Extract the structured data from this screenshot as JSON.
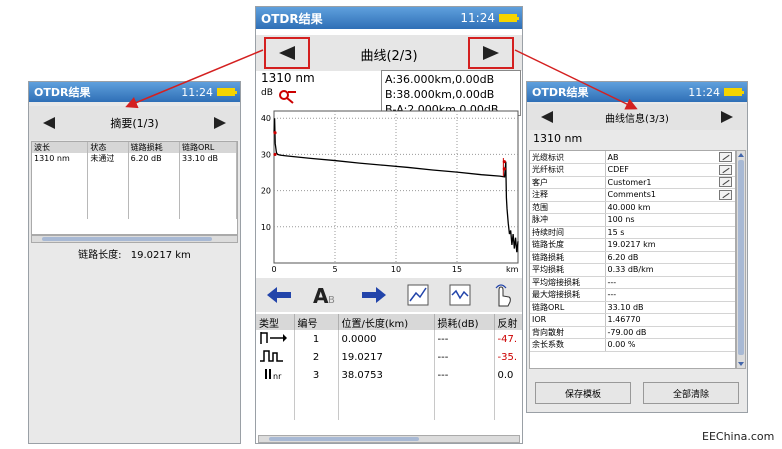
{
  "left": {
    "title": "OTDR结果",
    "time": "11:24",
    "nav_title": "摘要(1/3)",
    "columns": [
      "波长",
      "状态",
      "链路损耗",
      "链路ORL"
    ],
    "rows": [
      [
        "1310 nm",
        "未通过",
        "6.20 dB",
        "33.10 dB"
      ]
    ],
    "distance_label": "链路长度:",
    "distance_value": "19.0217 km"
  },
  "center": {
    "title": "OTDR结果",
    "time": "11:24",
    "nav_title": "曲线(2/3)",
    "wavelength": "1310 nm",
    "marker_a": "A:36.000km,0.00dB",
    "marker_b": "B:38.000km,0.00dB",
    "marker_ba": "B-A:2.000km,0.00dB",
    "y_unit": "dB",
    "x_unit": "km",
    "event_columns": [
      "类型",
      "编号",
      "位置/长度(km)",
      "损耗(dB)",
      "反射"
    ],
    "events": [
      {
        "type_icon": "launch-event-icon",
        "no": "1",
        "pos": "0.0000",
        "loss": "---",
        "refl": "-47.",
        "refl_color": "#cc0000"
      },
      {
        "type_icon": "reflective-event-icon",
        "no": "2",
        "pos": "19.0217",
        "loss": "---",
        "refl": "-35.",
        "refl_color": "#cc0000"
      },
      {
        "type_icon": "end-event-icon",
        "no": "3",
        "pos": "38.0753",
        "loss": "---",
        "refl": "0.0",
        "refl_color": "#000000"
      }
    ]
  },
  "right": {
    "title": "OTDR结果",
    "time": "11:24",
    "nav_title": "曲线信息(3/3)",
    "wavelength": "1310 nm",
    "info": [
      {
        "k": "光缆标识",
        "v": "AB",
        "edit": true
      },
      {
        "k": "光纤标识",
        "v": "CDEF",
        "edit": true
      },
      {
        "k": "客户",
        "v": "Customer1",
        "edit": true
      },
      {
        "k": "注释",
        "v": "Comments1",
        "edit": true
      },
      {
        "k": "范围",
        "v": "40.000 km",
        "edit": false
      },
      {
        "k": "脉冲",
        "v": "100 ns",
        "edit": false
      },
      {
        "k": "持续时间",
        "v": "15 s",
        "edit": false
      },
      {
        "k": "链路长度",
        "v": "19.0217 km",
        "edit": false
      },
      {
        "k": "链路损耗",
        "v": "6.20 dB",
        "edit": false
      },
      {
        "k": "平均损耗",
        "v": "0.33 dB/km",
        "edit": false
      },
      {
        "k": "平均熔接损耗",
        "v": "---",
        "edit": false
      },
      {
        "k": "最大熔接损耗",
        "v": "---",
        "edit": false
      },
      {
        "k": "链路ORL",
        "v": "33.10 dB",
        "edit": false
      },
      {
        "k": "IOR",
        "v": "1.46770",
        "edit": false
      },
      {
        "k": "背向散射",
        "v": "-79.00 dB",
        "edit": false
      },
      {
        "k": "余长系数",
        "v": "0.00 %",
        "edit": false
      }
    ],
    "save_label": "保存模板",
    "clear_label": "全部清除"
  },
  "watermark": "EEChina.com",
  "colors": {
    "titlebar": "#3a7cc4",
    "callout": "#d42020",
    "trace": "#000000",
    "marker": "#cc0000",
    "tool_blue": "#2244aa"
  },
  "chart_data": {
    "type": "line",
    "title": "",
    "xlabel": "km",
    "ylabel": "dB",
    "xlim": [
      0,
      20
    ],
    "ylim": [
      0,
      42
    ],
    "x_ticks": [
      0,
      5,
      10,
      15
    ],
    "y_ticks": [
      10,
      20,
      30,
      40
    ],
    "grid": true,
    "series": [
      {
        "x": [
          0,
          0.05,
          0.1,
          0.2,
          0.3,
          0.5,
          1,
          3,
          5,
          7,
          9,
          11,
          13,
          15,
          17,
          18.5,
          18.9,
          19.0,
          19.02,
          19.05,
          19.1,
          19.2,
          19.3,
          19.4,
          19.5,
          19.6,
          19.7,
          19.8,
          19.9,
          20
        ],
        "y": [
          36,
          40,
          33,
          30.5,
          30,
          29.8,
          29.6,
          28.9,
          28.3,
          27.6,
          27,
          26.4,
          25.7,
          25.1,
          24.4,
          24,
          23.8,
          28,
          23.5,
          18,
          15,
          11,
          8,
          9,
          5,
          8,
          4,
          7,
          3,
          6
        ]
      }
    ]
  }
}
